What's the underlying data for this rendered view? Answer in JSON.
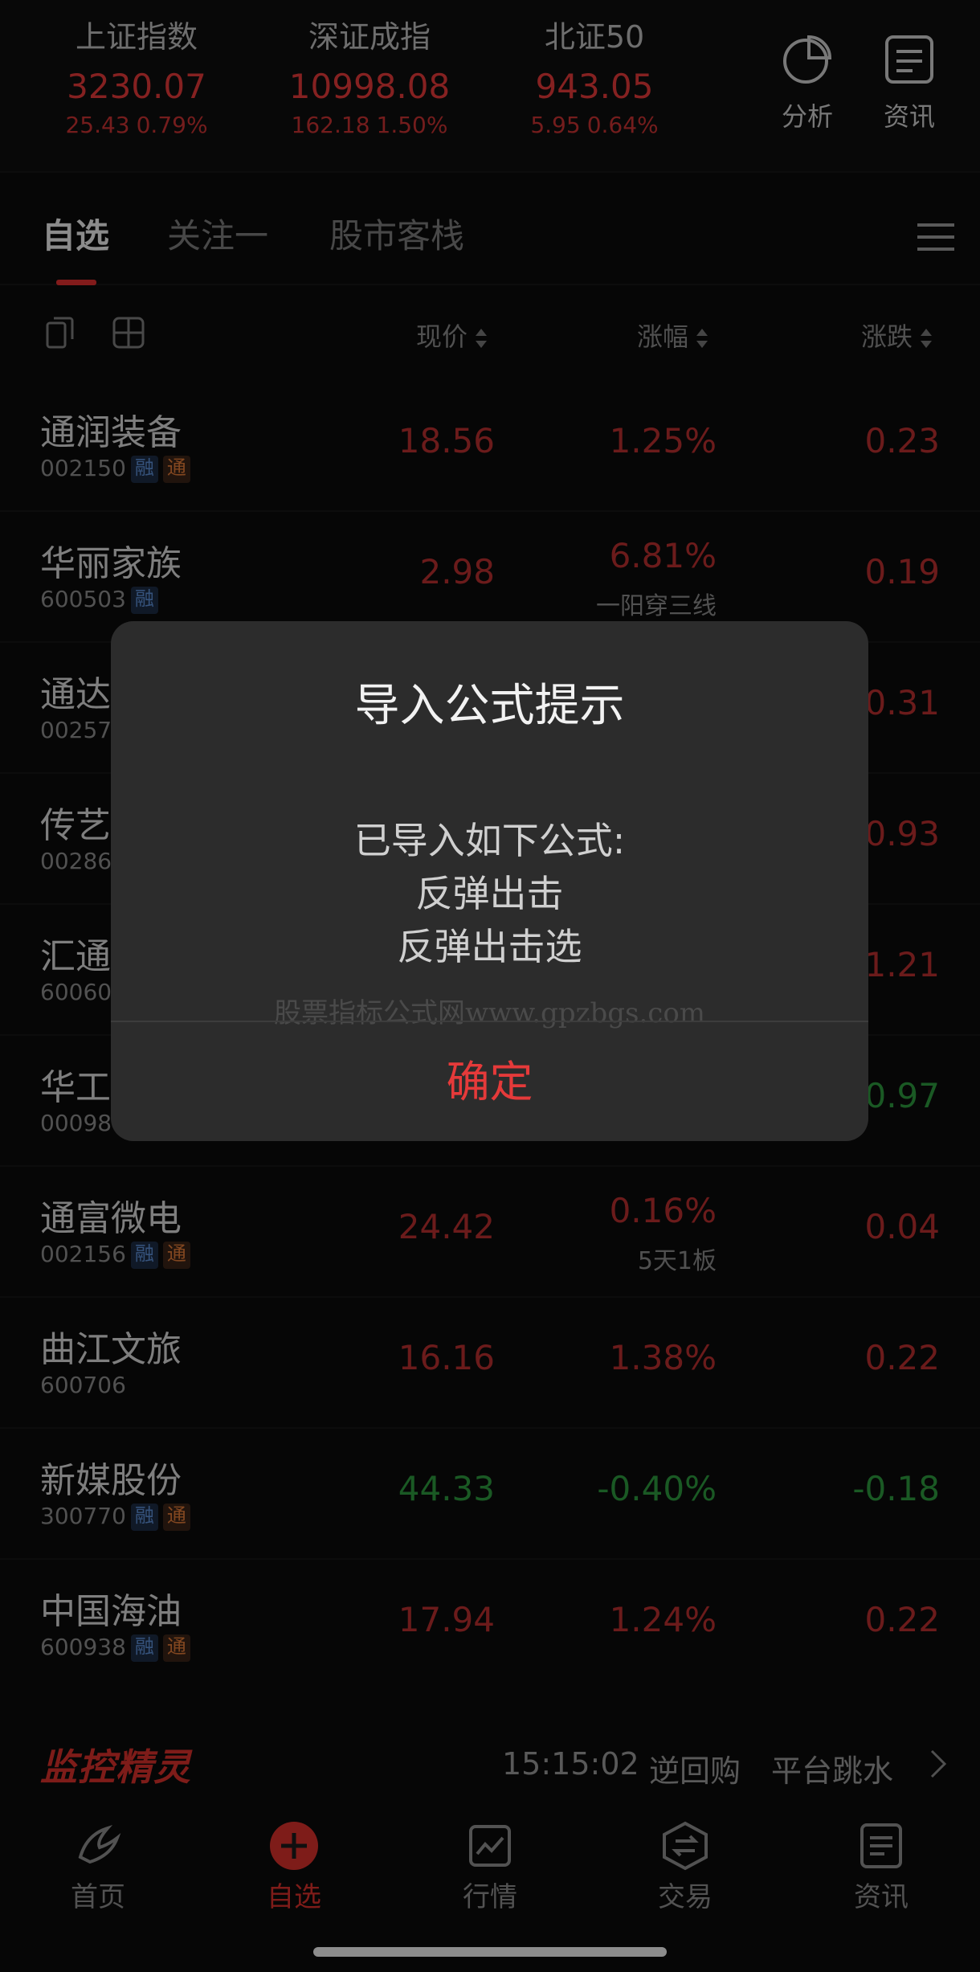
{
  "indices": [
    {
      "name": "上证指数",
      "value": "3230.07",
      "change": "25.43",
      "pct": "0.79%"
    },
    {
      "name": "深证成指",
      "value": "10998.08",
      "change": "162.18",
      "pct": "1.50%"
    },
    {
      "name": "北证50",
      "value": "943.05",
      "change": "5.95",
      "pct": "0.64%"
    }
  ],
  "top_tools": {
    "analysis": "分析",
    "news": "资讯"
  },
  "tabs": [
    "自选",
    "关注一",
    "股市客栈"
  ],
  "columns": {
    "price": "现价",
    "pct": "涨幅",
    "change": "涨跌"
  },
  "badges": {
    "rong": "融",
    "tong": "通"
  },
  "stocks": [
    {
      "name": "通润装备",
      "code": "002150",
      "price": "18.56",
      "pct": "1.25%",
      "change": "0.23",
      "note": ""
    },
    {
      "name": "华丽家族",
      "code": "600503",
      "price": "2.98",
      "pct": "6.81%",
      "change": "0.19",
      "note": "一阳穿三线"
    },
    {
      "name": "通达",
      "code": "00257",
      "price": "",
      "pct": "",
      "change": "0.31",
      "note": ""
    },
    {
      "name": "传艺",
      "code": "00286",
      "price": "",
      "pct": "",
      "change": "0.93",
      "note": ""
    },
    {
      "name": "汇通",
      "code": "60060",
      "price": "",
      "pct": "",
      "change": "1.21",
      "note": ""
    },
    {
      "name": "华工",
      "code": "00098",
      "price": "",
      "pct": "",
      "change": "0.97",
      "note": ""
    },
    {
      "name": "通富微电",
      "code": "002156",
      "price": "24.42",
      "pct": "0.16%",
      "change": "0.04",
      "note": "5天1板"
    },
    {
      "name": "曲江文旅",
      "code": "600706",
      "price": "16.16",
      "pct": "1.38%",
      "change": "0.22",
      "note": ""
    },
    {
      "name": "新媒股份",
      "code": "300770",
      "price": "44.33",
      "pct": "-0.40%",
      "change": "-0.18",
      "note": ""
    },
    {
      "name": "中国海油",
      "code": "600938",
      "price": "17.94",
      "pct": "1.24%",
      "change": "0.22",
      "note": ""
    }
  ],
  "monitor": {
    "logo": "监控精灵",
    "time": "15:15:02",
    "item1": "逆回购",
    "item2": "平台跳水"
  },
  "bottom_nav": [
    "首页",
    "自选",
    "行情",
    "交易",
    "资讯"
  ],
  "dialog": {
    "title": "导入公式提示",
    "line1": "已导入如下公式:",
    "line2": "反弹出击",
    "line3": "反弹出击选",
    "watermark": "股票指标公式网www.gpzbgs.com",
    "confirm": "确定"
  },
  "colors": {
    "up": "#b83030",
    "down": "#2d9a3e",
    "accent": "#d9312c"
  }
}
